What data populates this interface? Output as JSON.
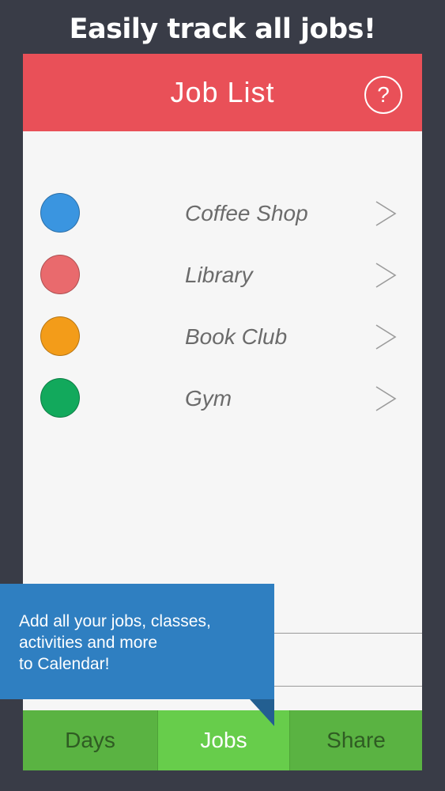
{
  "banner": {
    "headline": "Easily track all jobs!"
  },
  "header": {
    "title": "Job List",
    "help_label": "?"
  },
  "jobs": [
    {
      "name": "Coffee Shop",
      "color": "#3a95e0"
    },
    {
      "name": "Library",
      "color": "#e96a6d"
    },
    {
      "name": "Book Club",
      "color": "#f39c19"
    },
    {
      "name": "Gym",
      "color": "#12a95c"
    }
  ],
  "tabs": {
    "days": "Days",
    "jobs": "Jobs",
    "share": "Share"
  },
  "tooltip": {
    "line1": "Add all your jobs, classes,",
    "line2": "activities and more",
    "line3": "to Calendar!"
  },
  "colors": {
    "header": "#e95058",
    "tab_active": "#67cd4b",
    "tab_inactive": "#5ab342",
    "tooltip": "#2f7fc1",
    "background": "#393c47"
  }
}
